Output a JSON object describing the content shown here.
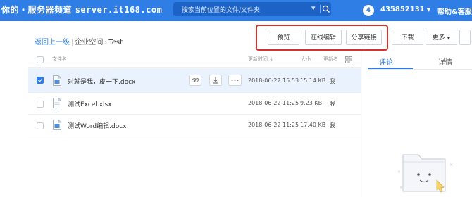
{
  "watermark": {
    "text": "你的・服务器频道",
    "site": "server.it168.com"
  },
  "search": {
    "placeholder": "搜索当前位置的文件/文件夹"
  },
  "header": {
    "notification_count": "4",
    "user_id": "435852131",
    "help_label": "帮助&客服"
  },
  "breadcrumb": {
    "back": "返回上一级",
    "parent": "企业空间",
    "current": "Test"
  },
  "toolbar": {
    "preview": "预览",
    "online_edit": "在线编辑",
    "share_link": "分享链接",
    "download": "下载",
    "more": "更多"
  },
  "columns": {
    "name": "文件名",
    "modified": "更新时间",
    "sort_arrow": "↓",
    "size": "大小",
    "updater": "更新者"
  },
  "files": [
    {
      "name": "对就是我，皮一下.docx",
      "modified": "2018-06-22 15:53",
      "size": "15.14 KB",
      "updater": "我",
      "selected": true,
      "type": "docx"
    },
    {
      "name": "测试Excel.xlsx",
      "modified": "2018-06-22 11:25",
      "size": "9.23 KB",
      "updater": "我",
      "selected": false,
      "type": "xlsx"
    },
    {
      "name": "测试Word编辑.docx",
      "modified": "2018-06-22 11:25",
      "size": "17.40 KB",
      "updater": "我",
      "selected": false,
      "type": "docx"
    }
  ],
  "panel": {
    "tab_comments": "评论",
    "tab_details": "详情"
  },
  "colors": {
    "header_blue": "#2f7ee6",
    "highlight_red": "#d6322c",
    "selected_row": "#eaf2fd"
  },
  "icons": [
    "search-icon",
    "caret-down-icon",
    "document-icon",
    "link-icon",
    "download-icon",
    "more-dots-icon",
    "grid-view-icon",
    "folder-illustration"
  ]
}
